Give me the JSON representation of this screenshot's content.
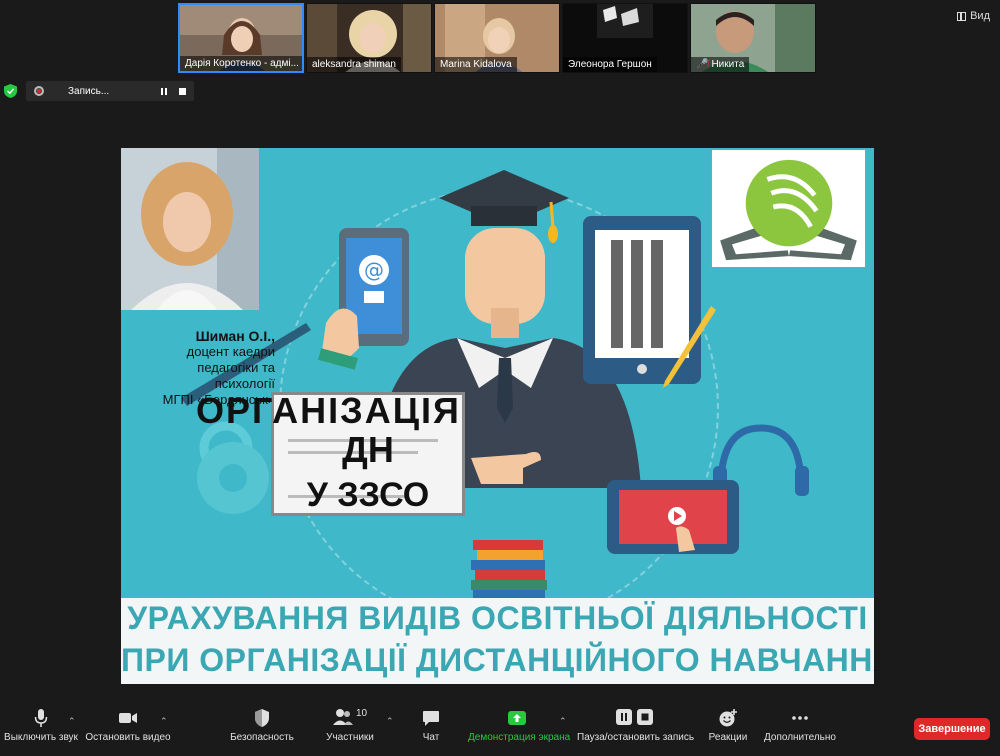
{
  "participants": [
    {
      "name": "Дарія Коротенко - адмі...",
      "muted": false,
      "active": true
    },
    {
      "name": "aleksandra shiman",
      "muted": false,
      "active": false
    },
    {
      "name": "Marina Kidalova",
      "muted": false,
      "active": false
    },
    {
      "name": "Элеонора Гершон",
      "muted": false,
      "active": false
    },
    {
      "name": "Никита",
      "muted": true,
      "active": false
    }
  ],
  "view_label": "Вид",
  "recording": {
    "label": "Запись..."
  },
  "slide": {
    "presenter_name": "Шиман О.І.,",
    "presenter_lines": [
      "доцент каедри",
      "педагогіки та",
      "психології",
      "МГПІ «Бердянськ»"
    ],
    "main_title": "ОРГАНІЗАЦІЯ",
    "cert_line1": "ДН",
    "cert_line2": "У ЗЗСО",
    "banner_line1": "УРАХУВАННЯ ВИДІВ ОСВІТНЬОЇ ДІЯЛЬНОСТІ",
    "banner_line2": "ПРИ ОРГАНІЗАЦІЇ ДИСТАНЦІЙНОГО НАВЧАННЯ"
  },
  "toolbar": {
    "mute": "Выключить звук",
    "video": "Остановить видео",
    "security": "Безопасность",
    "participants": "Участники",
    "participants_count": "10",
    "chat": "Чат",
    "share": "Демонстрация экрана",
    "record": "Пауза/остановить запись",
    "reactions": "Реакции",
    "more": "Дополнительно",
    "end": "Завершение"
  },
  "colors": {
    "accent": "#2d8cff",
    "end": "#e02828",
    "share_green": "#28c840",
    "slide_bg": "#3fb8c9",
    "banner_text": "#3aa7b3"
  }
}
